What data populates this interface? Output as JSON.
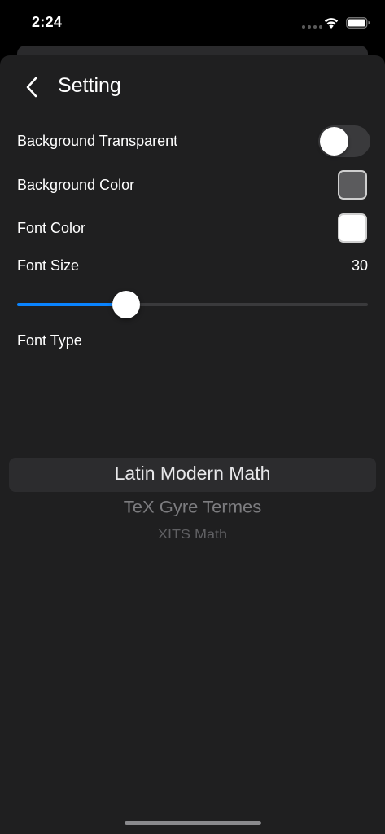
{
  "status_bar": {
    "time": "2:24",
    "wifi_icon": "wifi-icon",
    "battery_icon": "battery-icon"
  },
  "nav": {
    "back_icon": "chevron-left-icon",
    "title": "Setting"
  },
  "settings": {
    "background_transparent": {
      "label": "Background Transparent",
      "enabled": false
    },
    "background_color": {
      "label": "Background Color",
      "color": "#5b5b5d"
    },
    "font_color": {
      "label": "Font Color",
      "color": "#ffffff"
    },
    "font_size": {
      "label": "Font Size",
      "value": "30",
      "slider_fraction": 0.31
    },
    "font_type": {
      "label": "Font Type",
      "options": [
        "Latin Modern Math",
        "TeX Gyre Termes",
        "XITS Math"
      ],
      "selected": "Latin Modern Math"
    }
  },
  "colors": {
    "accent": "#0a84ff",
    "sheet_background": "#1f1f20",
    "toggle_off": "#3a3a3c"
  }
}
